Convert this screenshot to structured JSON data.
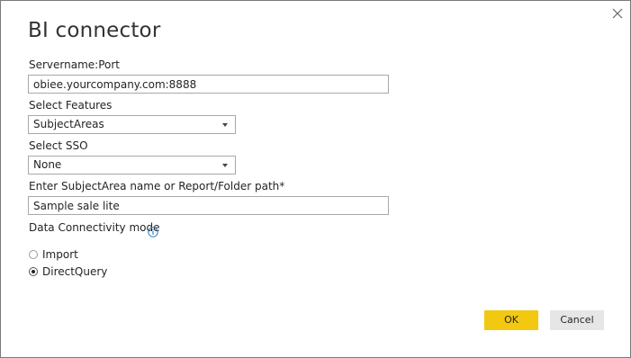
{
  "dialog": {
    "title": "BI connector",
    "close_icon": "close-icon"
  },
  "fields": {
    "server": {
      "label": "Servername:Port",
      "value": "obiee.yourcompany.com:8888"
    },
    "features": {
      "label": "Select Features",
      "selected": "SubjectAreas"
    },
    "sso": {
      "label": "Select SSO",
      "selected": "None"
    },
    "path": {
      "label": "Enter SubjectArea name or Report/Folder path*",
      "value": "Sample sale lite"
    }
  },
  "connectivity": {
    "label": "Data Connectivity mode",
    "info_icon": "info-icon",
    "options": [
      {
        "label": "Import",
        "checked": false
      },
      {
        "label": "DirectQuery",
        "checked": true
      }
    ]
  },
  "buttons": {
    "ok": "OK",
    "cancel": "Cancel"
  },
  "colors": {
    "primary_button": "#f2c811",
    "secondary_button": "#e6e6e6",
    "info_icon": "#2b78c5"
  }
}
